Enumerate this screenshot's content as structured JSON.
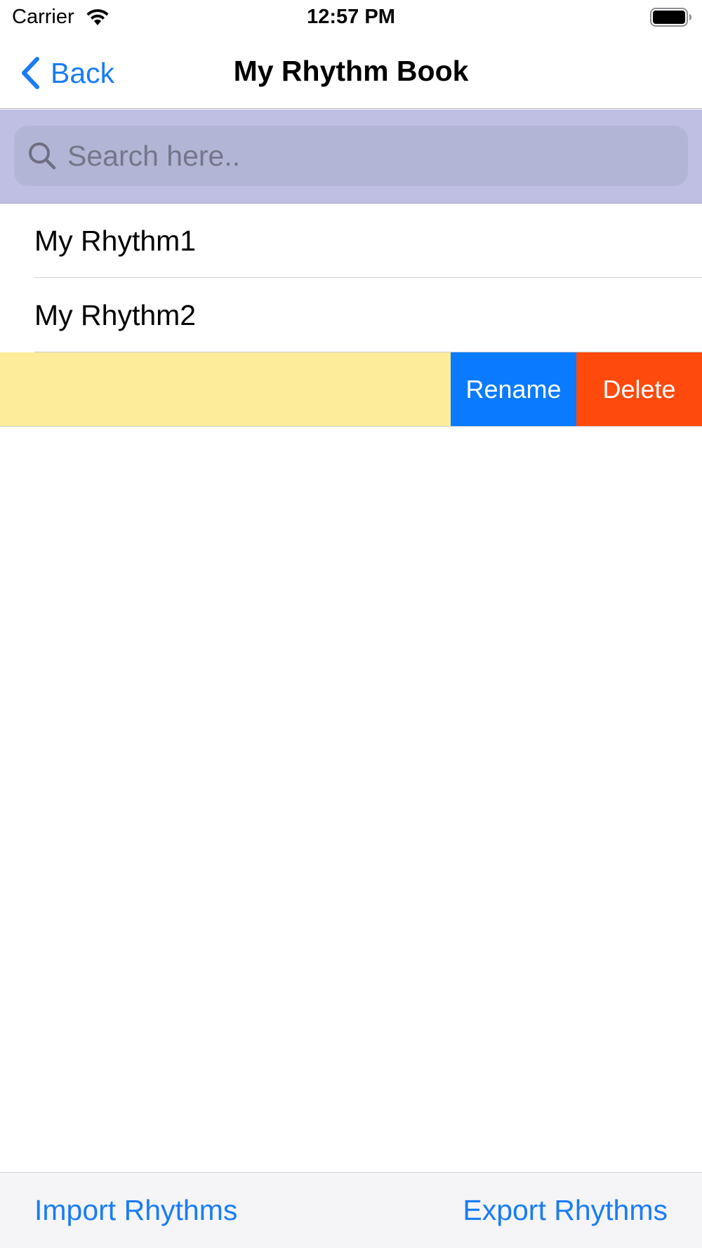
{
  "status_bar": {
    "carrier": "Carrier",
    "time": "12:57 PM",
    "wifi_icon": "wifi-icon",
    "battery_icon": "battery-icon"
  },
  "nav": {
    "back_label": "Back",
    "back_icon": "chevron-left-icon",
    "title": "My Rhythm Book"
  },
  "search": {
    "placeholder": "Search here..",
    "value": "",
    "icon": "search-icon"
  },
  "list": {
    "items": [
      {
        "label": "My Rhythm1"
      },
      {
        "label": "My Rhythm2"
      }
    ],
    "swiped_row": {
      "label": "",
      "rename_label": "Rename",
      "delete_label": "Delete"
    }
  },
  "toolbar": {
    "import_label": "Import Rhythms",
    "export_label": "Export Rhythms"
  },
  "colors": {
    "accent": "#1a7cf5",
    "search_bar_bg": "#bebfe2",
    "swiped_row_bg": "#fdec99",
    "rename_bg": "#0a7bff",
    "delete_bg": "#ff4a0e"
  }
}
